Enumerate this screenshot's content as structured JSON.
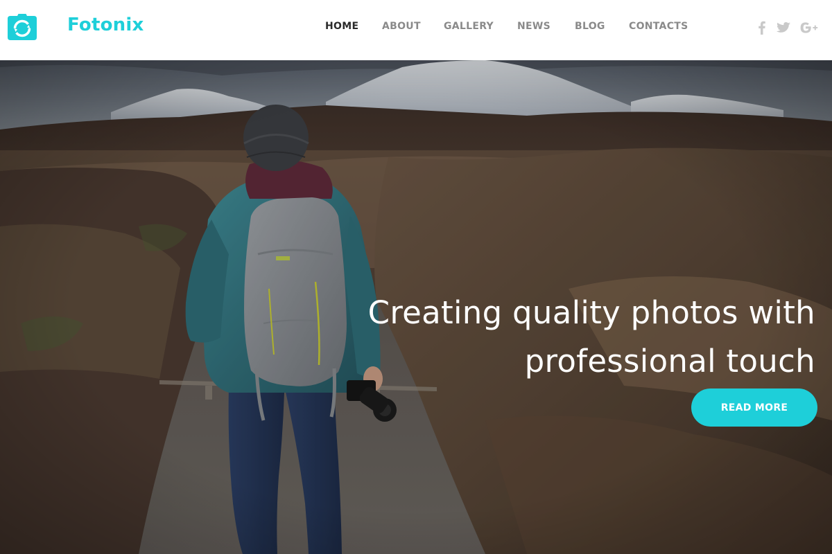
{
  "brand": {
    "name": "Fotonix",
    "logo_icon": "camera-icon",
    "accent_color": "#1ecfd9"
  },
  "nav": {
    "items": [
      {
        "label": "HOME",
        "active": true
      },
      {
        "label": "ABOUT",
        "active": false
      },
      {
        "label": "GALLERY",
        "active": false
      },
      {
        "label": "NEWS",
        "active": false
      },
      {
        "label": "BLOG",
        "active": false
      },
      {
        "label": "CONTACTS",
        "active": false
      }
    ]
  },
  "social": {
    "icons": [
      "facebook-icon",
      "twitter-icon",
      "google-plus-icon"
    ],
    "icon_color": "#c9c9c9"
  },
  "hero": {
    "headline_line1": "Creating quality photos with",
    "headline_line2": "professional touch",
    "cta_label": "READ MORE",
    "background_image": "hiker-with-camera-on-trail-icon"
  }
}
